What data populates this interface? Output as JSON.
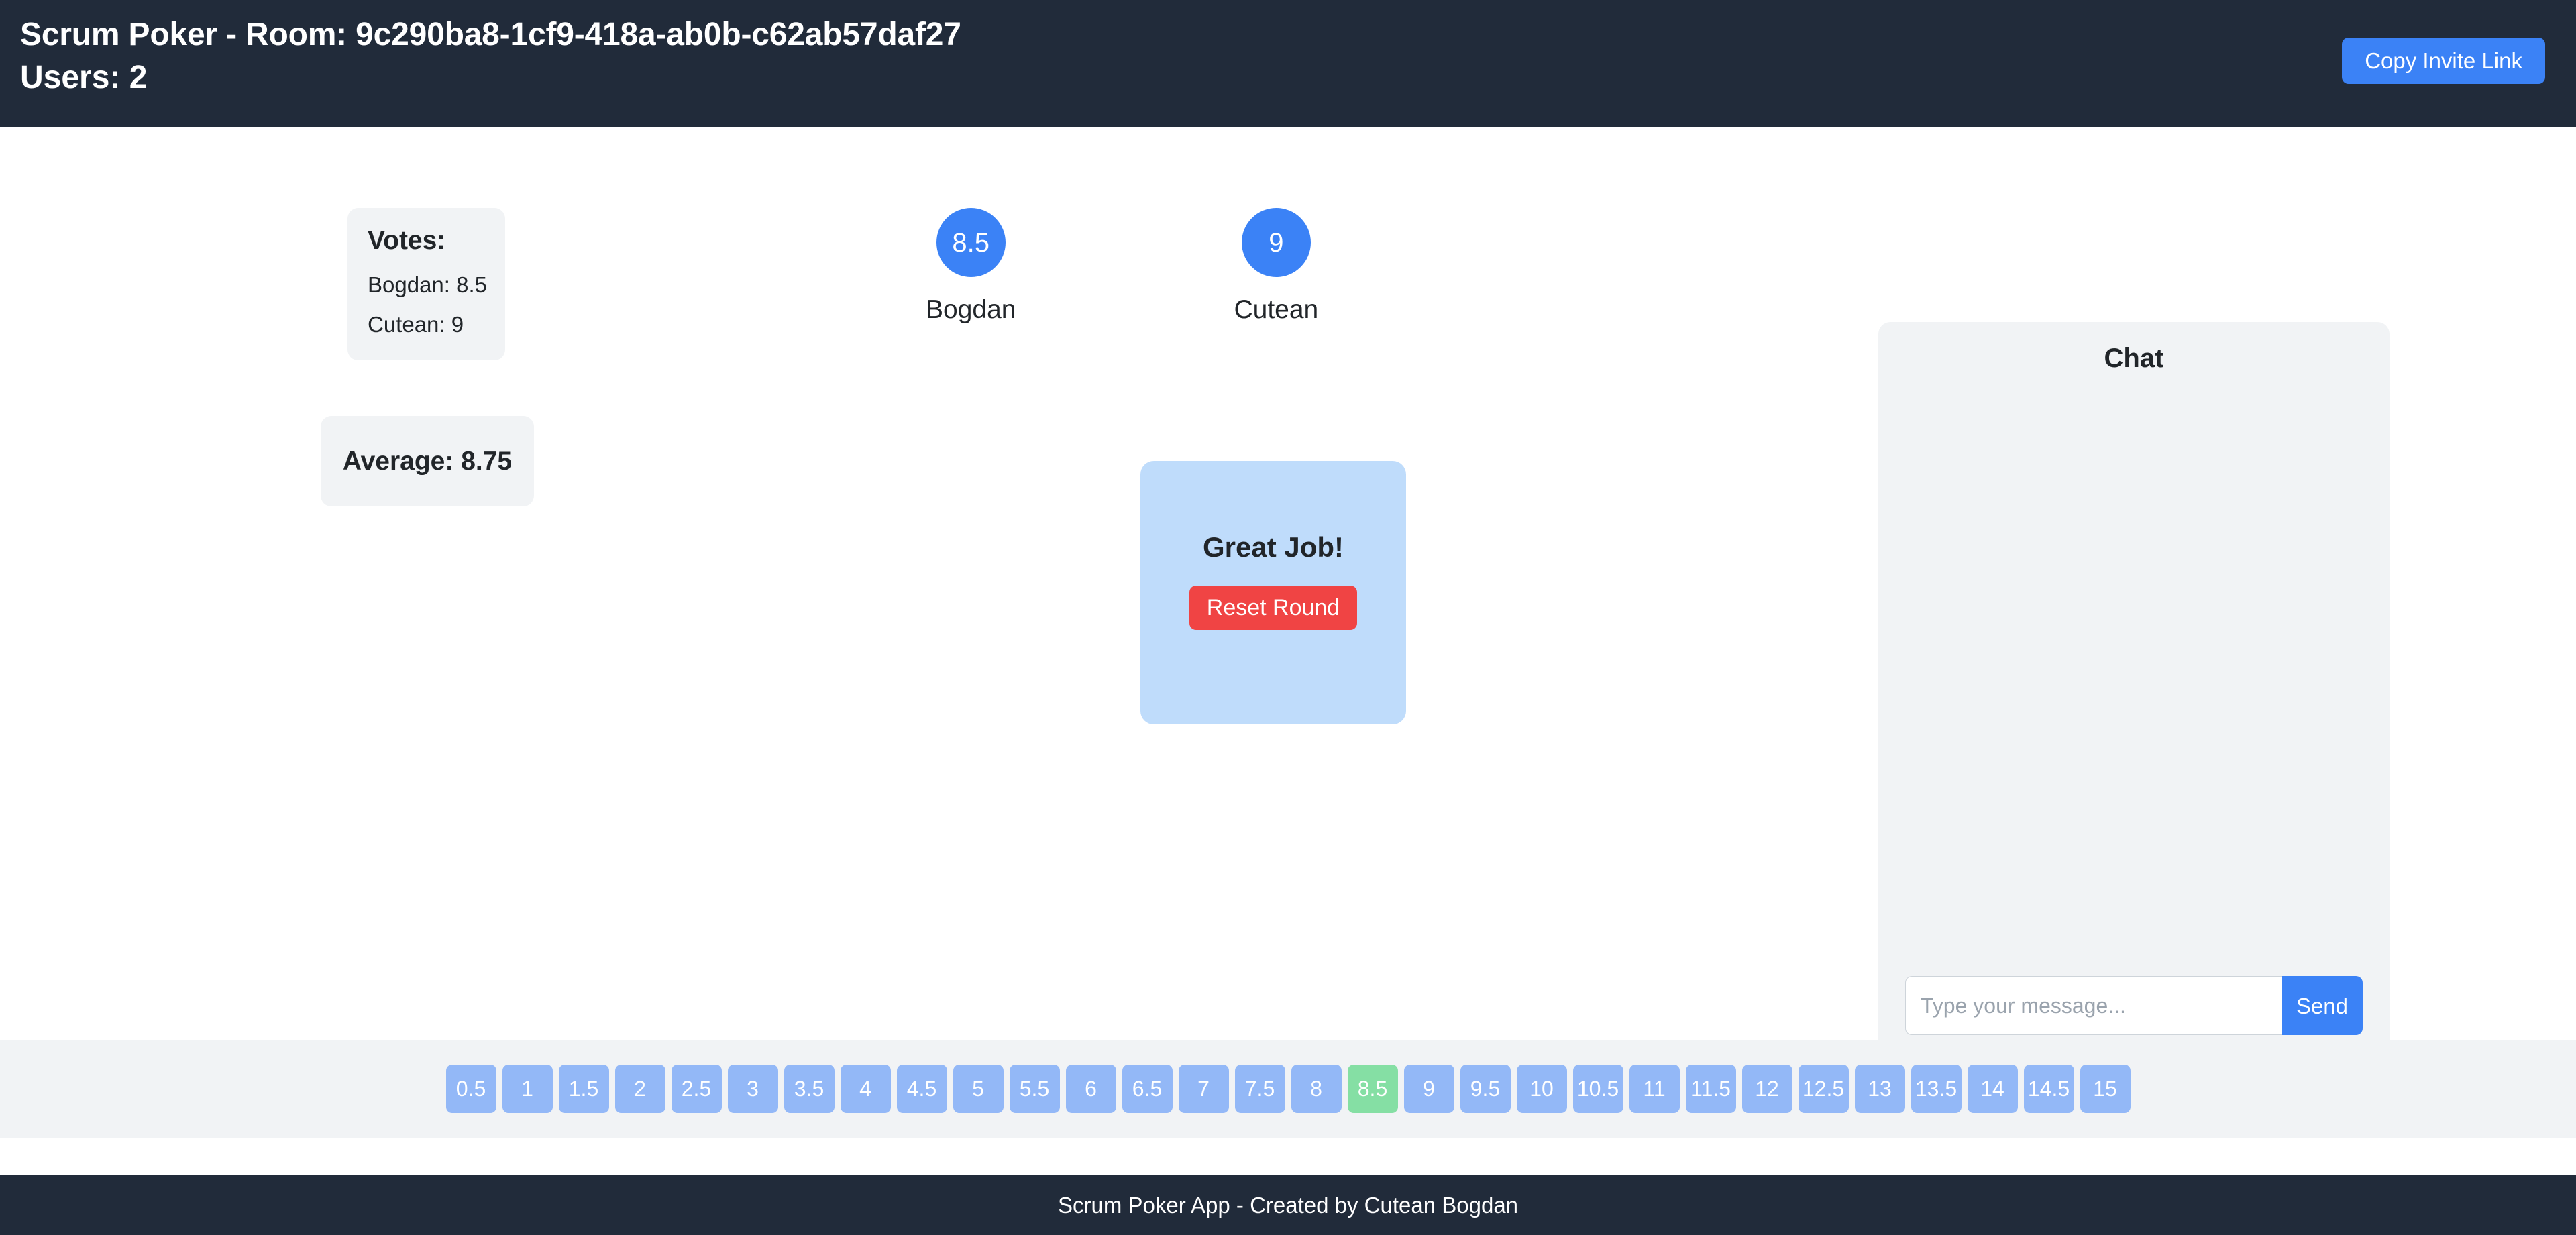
{
  "header": {
    "title": "Scrum Poker - Room: 9c290ba8-1cf9-418a-ab0b-c62ab57daf27",
    "users_label": "Users: 2",
    "copy_invite_label": "Copy Invite Link",
    "background_color": "#212b3a",
    "accent_color": "#3b82f6"
  },
  "votes_panel": {
    "heading": "Votes:",
    "entries": [
      {
        "label": "Bogdan: 8.5"
      },
      {
        "label": "Cutean: 9"
      }
    ],
    "average_label": "Average: 8.75"
  },
  "participants": [
    {
      "name": "Bogdan",
      "vote": "8.5"
    },
    {
      "name": "Cutean",
      "vote": "9"
    }
  ],
  "result_panel": {
    "title": "Great Job!",
    "reset_label": "Reset Round",
    "background_color": "#bfdcfb",
    "reset_color": "#f04444"
  },
  "chat": {
    "title": "Chat",
    "messages": [],
    "input_value": "",
    "input_placeholder": "Type your message...",
    "send_label": "Send"
  },
  "deck": {
    "selected_value": "8.5",
    "card_color": "#93b8f7",
    "selected_color": "#85dfa4",
    "cards": [
      "0.5",
      "1",
      "1.5",
      "2",
      "2.5",
      "3",
      "3.5",
      "4",
      "4.5",
      "5",
      "5.5",
      "6",
      "6.5",
      "7",
      "7.5",
      "8",
      "8.5",
      "9",
      "9.5",
      "10",
      "10.5",
      "11",
      "11.5",
      "12",
      "12.5",
      "13",
      "13.5",
      "14",
      "14.5",
      "15"
    ]
  },
  "footer": {
    "text": "Scrum Poker App - Created by Cutean Bogdan"
  }
}
